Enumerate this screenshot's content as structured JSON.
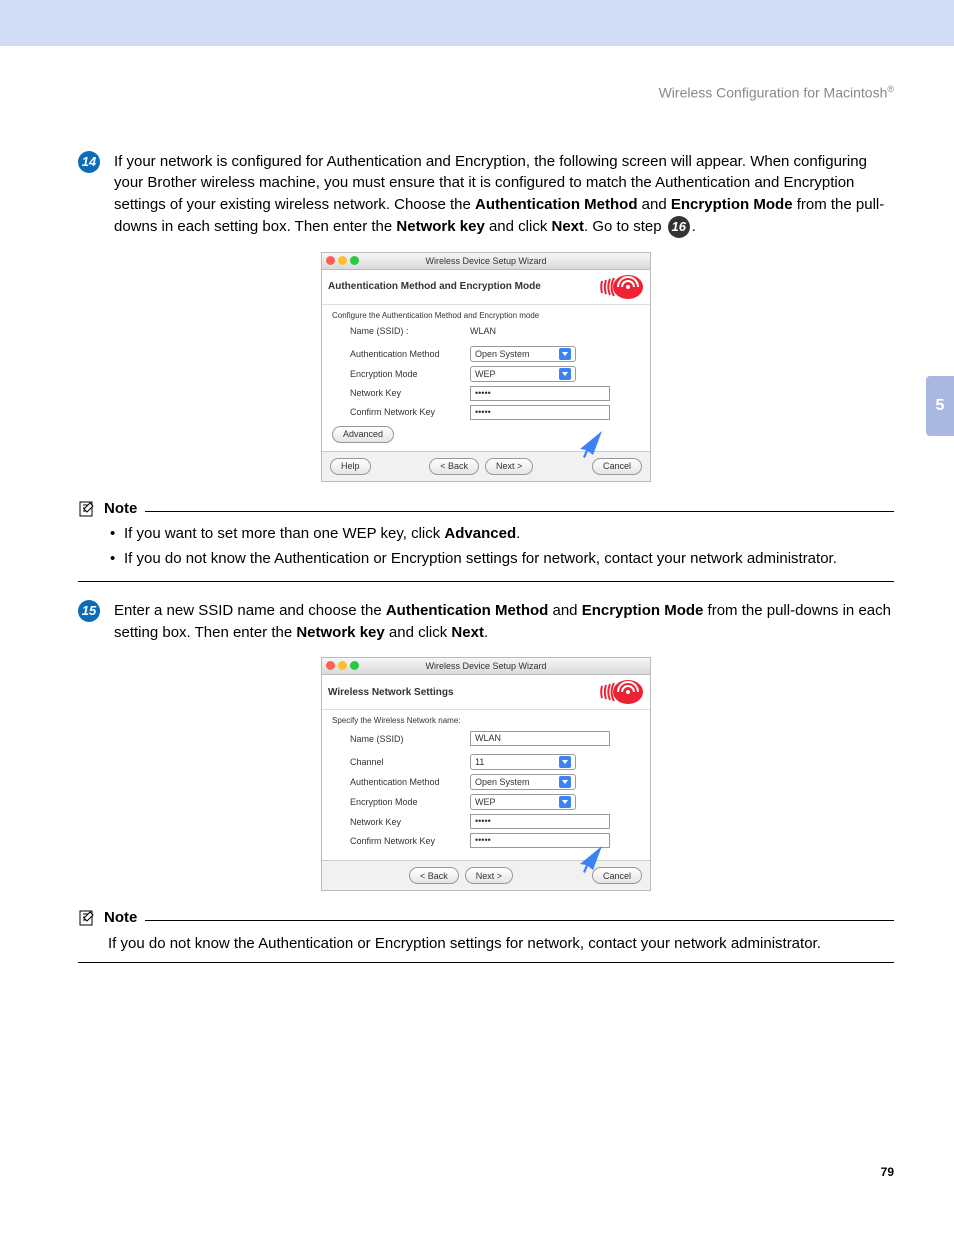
{
  "header": {
    "text": "Wireless Configuration for Macintosh",
    "reg": "®"
  },
  "chapter": "5",
  "page_num": "79",
  "step14": {
    "num": "14",
    "t1": "If your network is configured for Authentication and Encryption, the following screen will appear. When configuring your Brother wireless machine, you must ensure that it is configured to match the Authentication and Encryption settings of your existing wireless network. Choose the ",
    "b1": "Authentication Method",
    "t2": " and ",
    "b2": "Encryption Mode",
    "t3": " from the pull-downs in each setting box. Then enter the ",
    "b3": "Network key",
    "t4": " and click ",
    "b4": "Next",
    "t5": ". Go to step ",
    "ref": "16",
    "t6": "."
  },
  "shot1": {
    "title": "Wireless Device Setup Wizard",
    "heading": "Authentication Method and Encryption Mode",
    "sub": "Configure the Authentication Method and Encryption mode",
    "nameLbl": "Name (SSID) :",
    "nameVal": "WLAN",
    "authLbl": "Authentication Method",
    "authVal": "Open System",
    "encLbl": "Encryption Mode",
    "encVal": "WEP",
    "nkLbl": "Network Key",
    "nkVal": "•••••",
    "cnkLbl": "Confirm Network Key",
    "cnkVal": "•••••",
    "adv": "Advanced",
    "help": "Help",
    "back": "< Back",
    "next": "Next >",
    "cancel": "Cancel"
  },
  "note1": {
    "title": "Note",
    "i1a": "If you want to set more than one WEP key, click ",
    "i1b": "Advanced",
    "i1c": ".",
    "i2": "If you do not know the Authentication or Encryption settings for network, contact your network administrator."
  },
  "step15": {
    "num": "15",
    "t1": "Enter a new SSID name and choose the ",
    "b1": "Authentication Method",
    "t2": " and ",
    "b2": "Encryption Mode",
    "t3": " from the pull-downs in each setting box. Then enter the ",
    "b3": "Network key",
    "t4": " and click ",
    "b4": "Next",
    "t5": "."
  },
  "shot2": {
    "title": "Wireless Device Setup Wizard",
    "heading": "Wireless Network Settings",
    "sub": "Specify the Wireless Network name:",
    "nameLbl": "Name (SSID)",
    "nameVal": "WLAN",
    "chLbl": "Channel",
    "chVal": "11",
    "authLbl": "Authentication Method",
    "authVal": "Open System",
    "encLbl": "Encryption Mode",
    "encVal": "WEP",
    "nkLbl": "Network Key",
    "nkVal": "•••••",
    "cnkLbl": "Confirm Network Key",
    "cnkVal": "•••••",
    "back": "< Back",
    "next": "Next >",
    "cancel": "Cancel"
  },
  "note2": {
    "title": "Note",
    "body": "If you do not know the Authentication or Encryption settings for network, contact your network administrator."
  }
}
